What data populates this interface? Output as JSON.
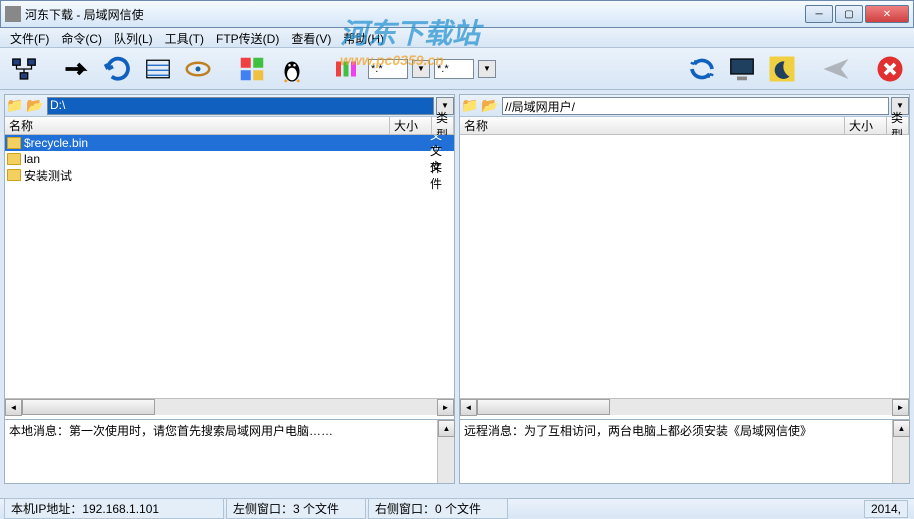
{
  "window": {
    "title": "河东下载 - 局域网信使"
  },
  "menu": {
    "file": "文件(F)",
    "cmd": "命令(C)",
    "queue": "队列(L)",
    "tools": "工具(T)",
    "ftp": "FTP传送(D)",
    "view": "查看(V)",
    "help": "帮助(H)"
  },
  "toolbar": {
    "filter1": "*.*",
    "filter2": "*.*"
  },
  "left": {
    "path": "D:\\",
    "header": {
      "name": "名称",
      "size": "大小",
      "type": "类型"
    },
    "rows": [
      {
        "name": "$recycle.bin",
        "type": "文件"
      },
      {
        "name": "lan",
        "type": "文件"
      },
      {
        "name": "安装测试",
        "type": "文件"
      }
    ],
    "message": "本地消息：第一次使用时，请您首先搜索局域网用户电脑……"
  },
  "right": {
    "path": "//局域网用户/",
    "header": {
      "name": "名称",
      "size": "大小",
      "type": "类型"
    },
    "message": "远程消息：为了互相访问，两台电脑上都必须安装《局域网信使》"
  },
  "status": {
    "ip": "本机IP地址：192.168.1.101",
    "left": "左侧窗口：3 个文件",
    "right": "右侧窗口：0 个文件",
    "year": "2014,"
  },
  "watermark": {
    "line1": "河东下载站",
    "line2": "www.pc0359.cn"
  }
}
